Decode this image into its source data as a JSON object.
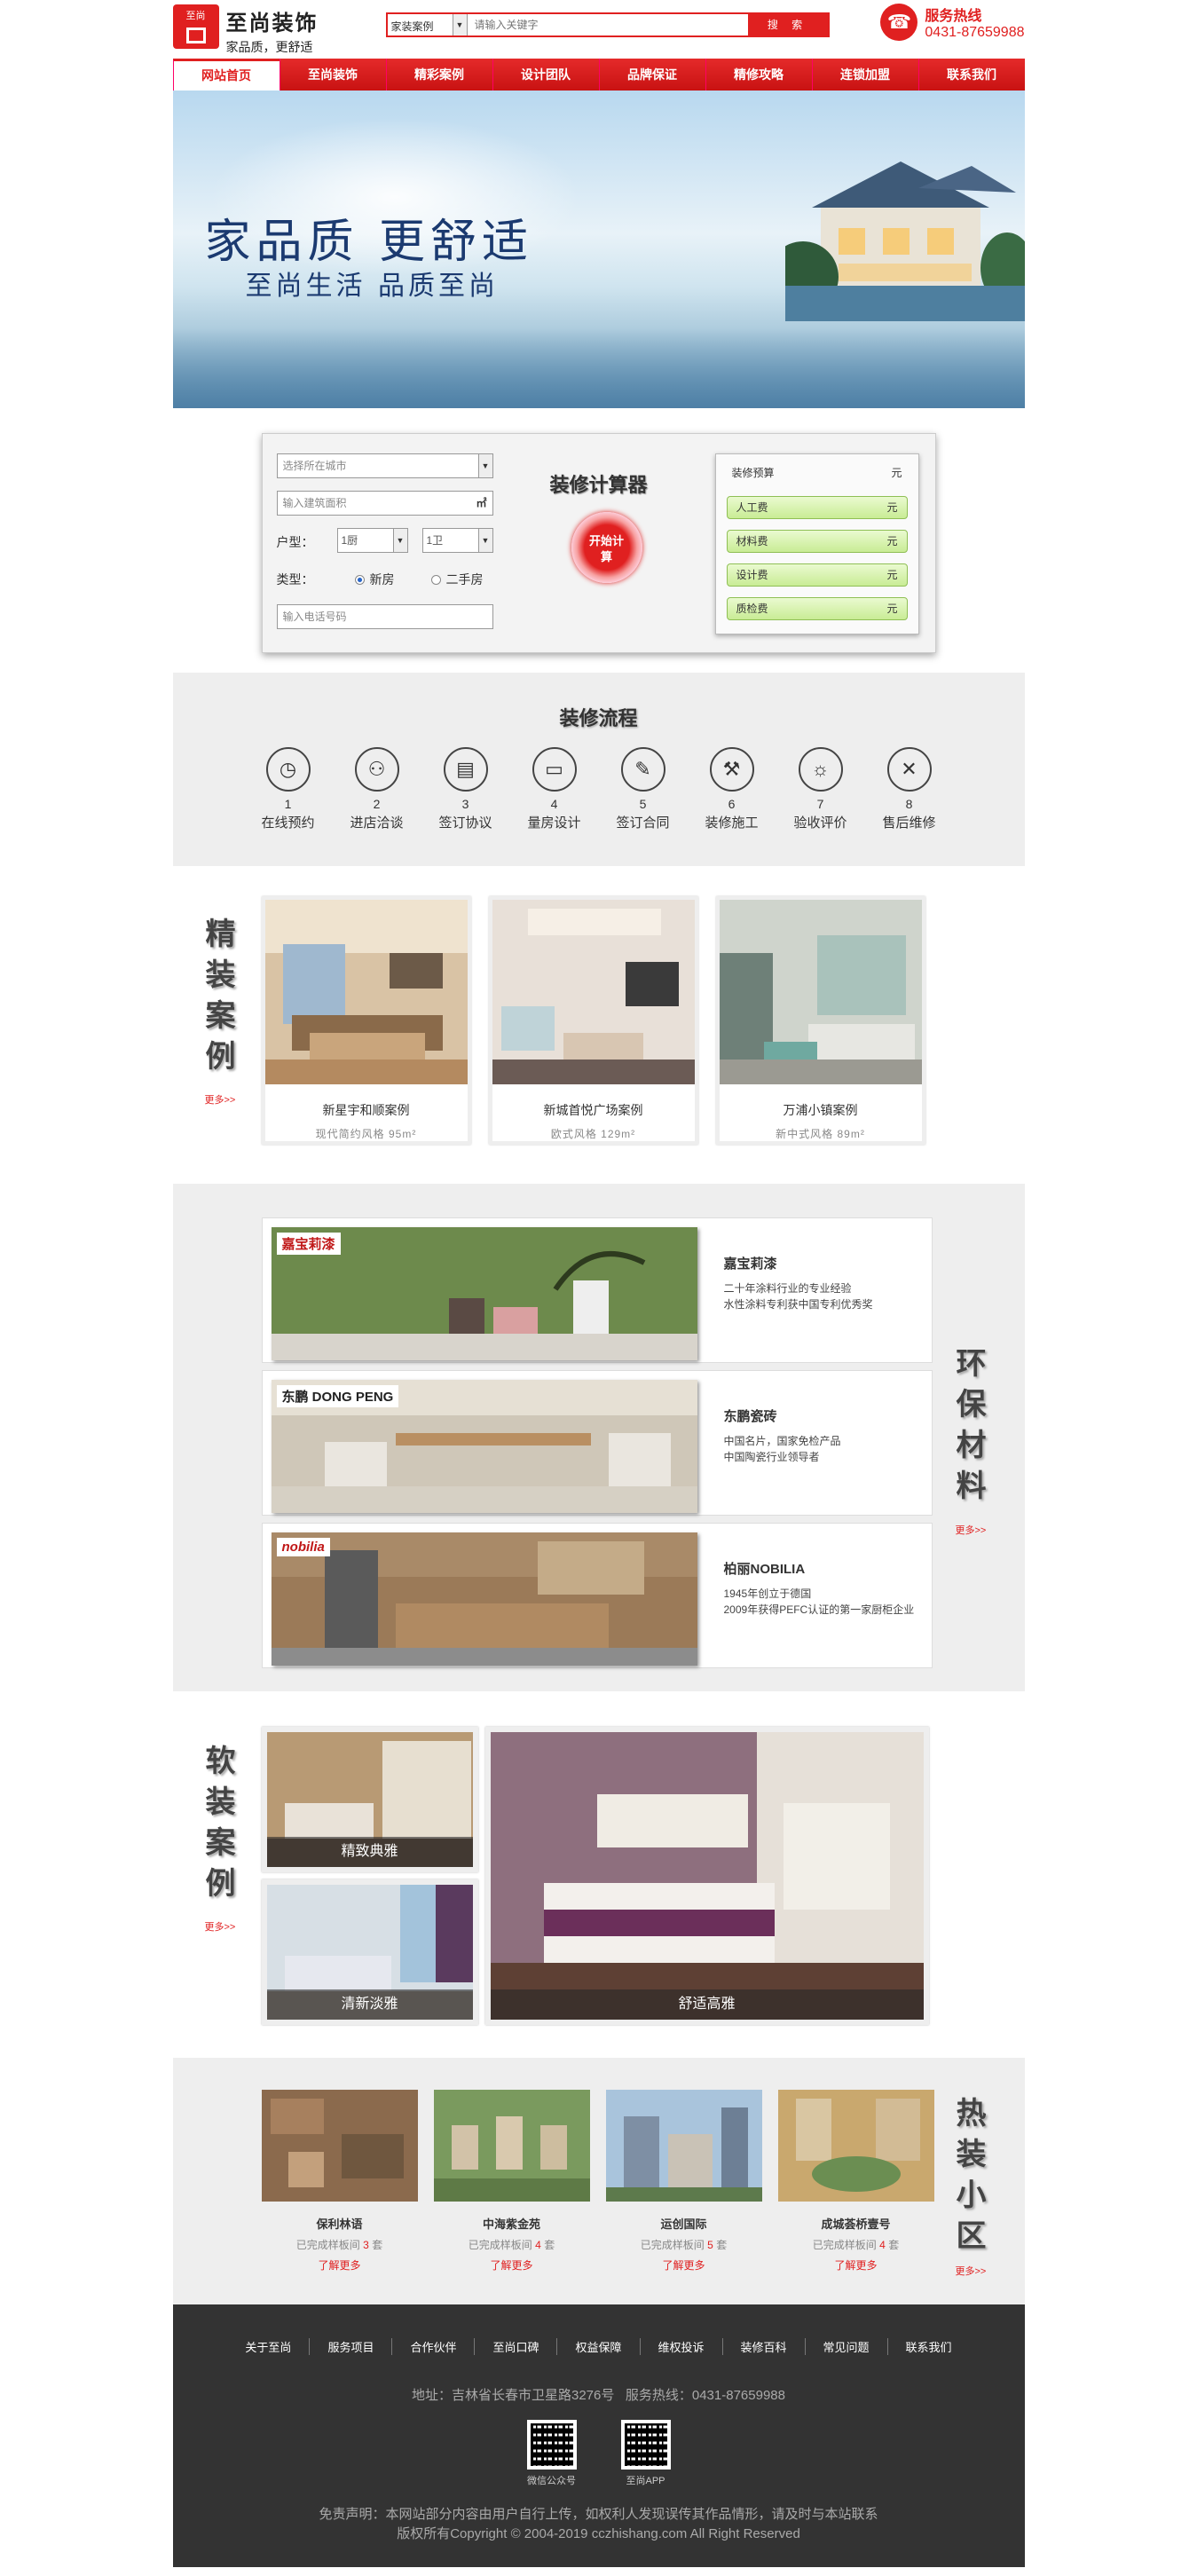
{
  "header": {
    "brand_name": "至尚装饰",
    "brand_slogan": "家品质，更舒适",
    "logo_text": "至尚",
    "search_category": "家装案例",
    "search_placeholder": "请输入关键字",
    "search_button": "搜 索",
    "hotline_label": "服务热线",
    "hotline_number": "0431-87659988"
  },
  "nav": [
    "网站首页",
    "至尚装饰",
    "精彩案例",
    "设计团队",
    "品牌保证",
    "精修攻略",
    "连锁加盟",
    "联系我们"
  ],
  "banner": {
    "line1": "家品质  更舒适",
    "line2": "至尚生活  品质至尚"
  },
  "calculator": {
    "city_placeholder": "选择所在城市",
    "area_placeholder": "输入建筑面积",
    "area_unit": "㎡",
    "huxing_label": "户型：",
    "room_value": "1厨",
    "bath_value": "1卫",
    "type_label": "类型：",
    "type_new": "新房",
    "type_used": "二手房",
    "phone_placeholder": "输入电话号码",
    "title": "装修计算器",
    "start_button": "开始计算",
    "budget_label": "装修预算",
    "unit": "元",
    "costs": [
      "人工费",
      "材料费",
      "设计费",
      "质检费"
    ]
  },
  "process": {
    "title": "装修流程",
    "steps": [
      {
        "num": "1",
        "name": "在线预约"
      },
      {
        "num": "2",
        "name": "进店洽谈"
      },
      {
        "num": "3",
        "name": "签订协议"
      },
      {
        "num": "4",
        "name": "量房设计"
      },
      {
        "num": "5",
        "name": "签订合同"
      },
      {
        "num": "6",
        "name": "装修施工"
      },
      {
        "num": "7",
        "name": "验收评价"
      },
      {
        "num": "8",
        "name": "售后维修"
      }
    ]
  },
  "cases": {
    "title": "精装案例",
    "more": "更多>>",
    "items": [
      {
        "title": "新星宇和顺案例",
        "meta": "现代简约风格    95m²"
      },
      {
        "title": "新城首悦广场案例",
        "meta": "欧式风格    129m²"
      },
      {
        "title": "万浦小镇案例",
        "meta": "新中式风格    89m²"
      }
    ]
  },
  "materials": {
    "title": "环保材料",
    "more": "更多>>",
    "items": [
      {
        "logo": "嘉宝莉漆",
        "name": "嘉宝莉漆",
        "desc": "二十年涂料行业的专业经验\n水性涂料专利获中国专利优秀奖"
      },
      {
        "logo": "东鹏 DONG PENG",
        "name": "东鹏瓷砖",
        "desc": "中国名片，国家免检产品\n中国陶瓷行业领导者"
      },
      {
        "logo": "nobilia",
        "name": "柏丽NOBILIA",
        "desc": "1945年创立于德国\n2009年获得PEFC认证的第一家厨柜企业"
      }
    ]
  },
  "soft": {
    "title": "软装案例",
    "more": "更多>>",
    "items": [
      "精致典雅",
      "清新淡雅",
      "舒适高雅"
    ]
  },
  "hot": {
    "title": "热装小区",
    "more": "更多>>",
    "done_prefix": "已完成样板间",
    "done_suffix": "套",
    "link": "了解更多",
    "items": [
      {
        "name": "保利林语",
        "count": "3"
      },
      {
        "name": "中海紫金苑",
        "count": "4"
      },
      {
        "name": "运创国际",
        "count": "5"
      },
      {
        "name": "成城荟桥壹号",
        "count": "4"
      }
    ]
  },
  "footer": {
    "links": [
      "关于至尚",
      "服务项目",
      "合作伙伴",
      "至尚口碑",
      "权益保障",
      "维权投诉",
      "装修百科",
      "常见问题",
      "联系我们"
    ],
    "address": "地址：吉林省长春市卫星路3276号   服务热线：0431-87659988",
    "qr1": "微信公众号",
    "qr2": "至尚APP",
    "disclaimer": "免责声明：本网站部分内容由用户自行上传，如权利人发现误传其作品情形，请及时与本站联系",
    "copyright": "版权所有Copyright © 2004-2019 cczhishang.com All Right Reserved"
  },
  "colors": {
    "brand_red": "#e02020",
    "section_grey": "#eeeeee",
    "footer_bg": "#333333"
  }
}
